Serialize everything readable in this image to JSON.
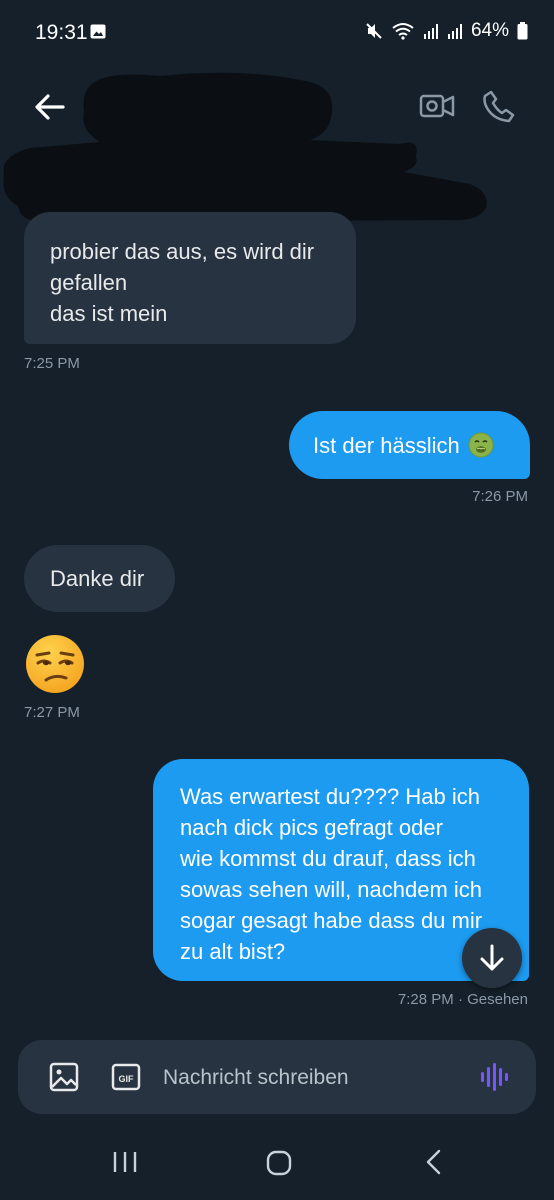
{
  "status_bar": {
    "time": "19:31",
    "battery": "64%"
  },
  "messages": [
    {
      "side": "received",
      "lines": [
        "probier das aus, es wird dir",
        "gefallen",
        "das ist mein"
      ],
      "timestamp": "7:25 PM"
    },
    {
      "side": "sent",
      "text": "Ist der hässlich",
      "emoji": "nauseated-face",
      "timestamp": "7:26 PM"
    },
    {
      "side": "received",
      "text": "Danke dir"
    },
    {
      "side": "received",
      "emoji": "unamused-face",
      "timestamp": "7:27 PM"
    },
    {
      "side": "sent",
      "lines": [
        "Was erwartest du???? Hab ich",
        "nach dick pics gefragt oder",
        "wie kommst du drauf, dass ich",
        "sowas sehen will, nachdem ich",
        "sogar gesagt habe dass du mir",
        "zu alt bist?"
      ],
      "timestamp": "7:28 PM · Gesehen"
    }
  ],
  "composer": {
    "placeholder": "Nachricht schreiben",
    "gif_label": "GIF"
  },
  "icons": [
    "back-arrow-icon",
    "video-call-icon",
    "phone-icon",
    "image-icon",
    "gif-icon",
    "voice-icon",
    "arrow-down-icon",
    "recent-apps-icon",
    "home-icon",
    "nav-back-icon"
  ],
  "colors": {
    "background": "#15202b",
    "received_bubble": "#273340",
    "sent_bubble": "#1d9bf0",
    "voice_accent": "#7856ff"
  }
}
